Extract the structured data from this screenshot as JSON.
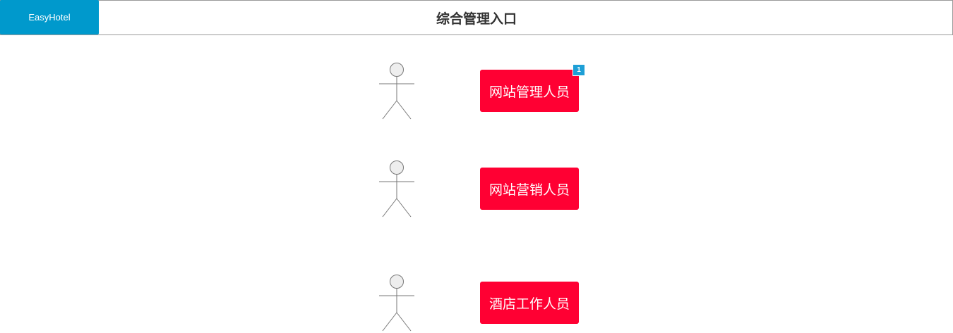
{
  "header": {
    "logo_label": "EasyHotel",
    "title": "综合管理入口"
  },
  "roles": [
    {
      "label": "网站管理人员",
      "badge": "1"
    },
    {
      "label": "网站营销人员"
    },
    {
      "label": "酒店工作人员"
    }
  ],
  "colors": {
    "logo_bg": "#0099cc",
    "role_bg": "#ff0033",
    "badge_bg": "#1e9fd6"
  },
  "icons": {
    "actor": "stick-figure-actor-icon"
  }
}
